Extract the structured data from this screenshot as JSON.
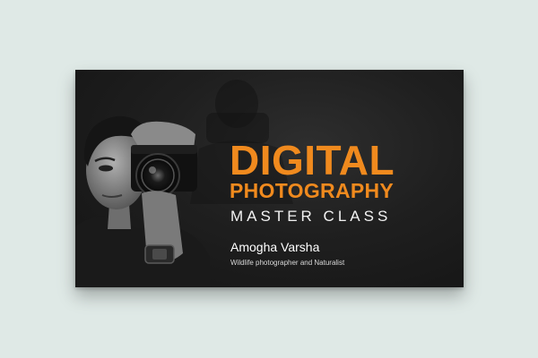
{
  "card": {
    "title_line1": "DIGITAL",
    "title_line2": "PHOTOGRAPHY",
    "subtitle": "MASTER CLASS",
    "presenter_name": "Amogha Varsha",
    "presenter_role": "Wildlife photographer and Naturalist"
  },
  "colors": {
    "background": "#dfe9e6",
    "card": "#1c1c1c",
    "accent": "#f08a1e",
    "text": "#ffffff"
  },
  "image": {
    "subject": "photographer-with-camera"
  }
}
